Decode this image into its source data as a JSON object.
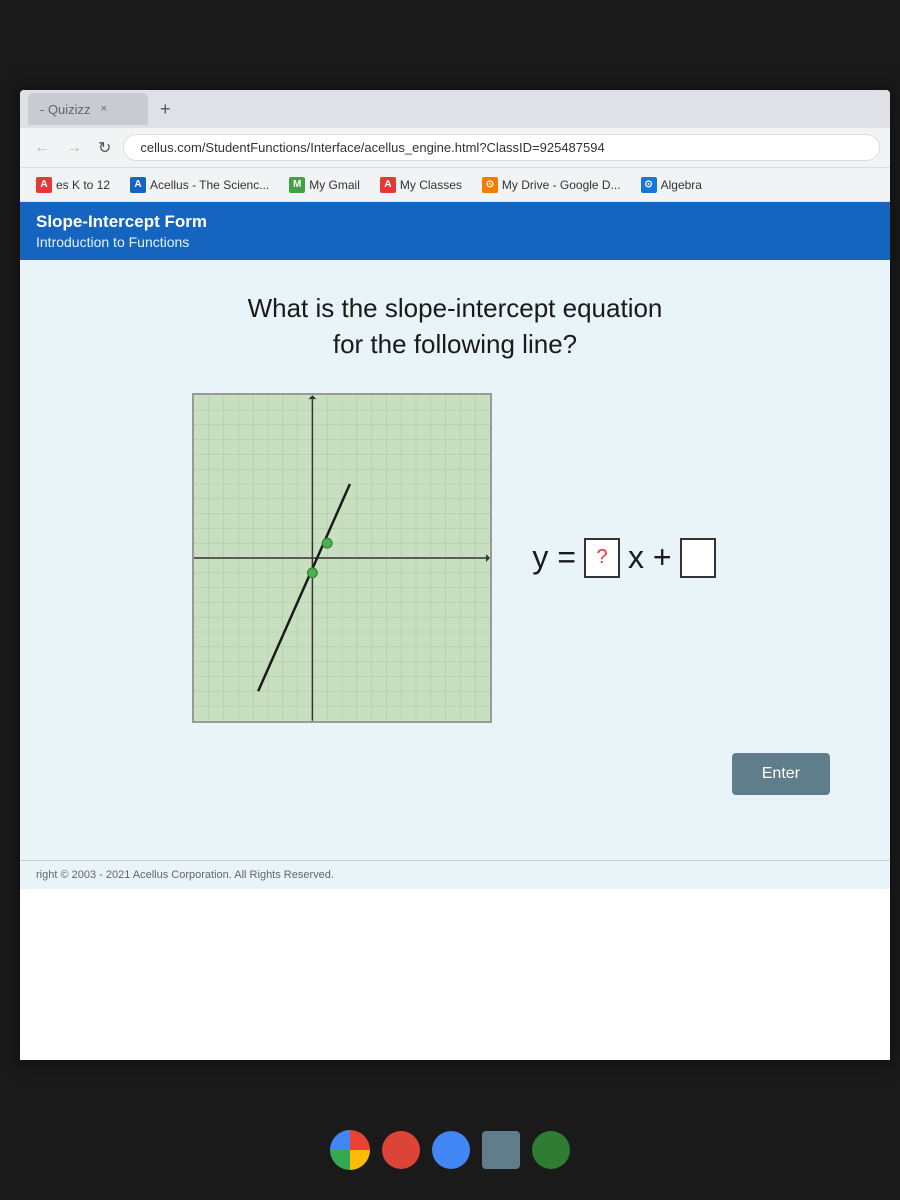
{
  "browser": {
    "tab_label": "- Quizizz",
    "tab_close": "×",
    "tab_new": "+",
    "address": "cellus.com/StudentFunctions/Interface/acellus_engine.html?ClassID=925487594",
    "nav_back": "←",
    "nav_forward": "→",
    "nav_refresh": "↻"
  },
  "bookmarks": [
    {
      "id": "k12",
      "label": "es K to 12",
      "icon": "A",
      "icon_class": "red"
    },
    {
      "id": "acellus",
      "label": "Acellus - The Scienc...",
      "icon": "A",
      "icon_class": "blue-a"
    },
    {
      "id": "gmail",
      "label": "My Gmail",
      "icon": "M",
      "icon_class": "green-m"
    },
    {
      "id": "myclasses",
      "label": "My Classes",
      "icon": "A",
      "icon_class": "red-a"
    },
    {
      "id": "mydrive",
      "label": "My Drive - Google D...",
      "icon": "◉",
      "icon_class": "orange"
    },
    {
      "id": "algebra",
      "label": "Algebra",
      "icon": "◉",
      "icon_class": "blue-g"
    }
  ],
  "acellus": {
    "course_title": "Slope-Intercept Form",
    "course_subtitle": "Introduction to Functions",
    "question": "What is the slope-intercept equation\nfor the following line?",
    "equation_prefix": "y = ",
    "bracket_1": "?",
    "eq_middle": "x + ",
    "bracket_2": "",
    "enter_label": "Enter",
    "footer": "right © 2003 - 2021 Acellus Corporation. All Rights Reserved."
  },
  "taskbar": {
    "icons": [
      "🌐",
      "🔵",
      "🔵",
      "⬜",
      "🟢"
    ]
  }
}
